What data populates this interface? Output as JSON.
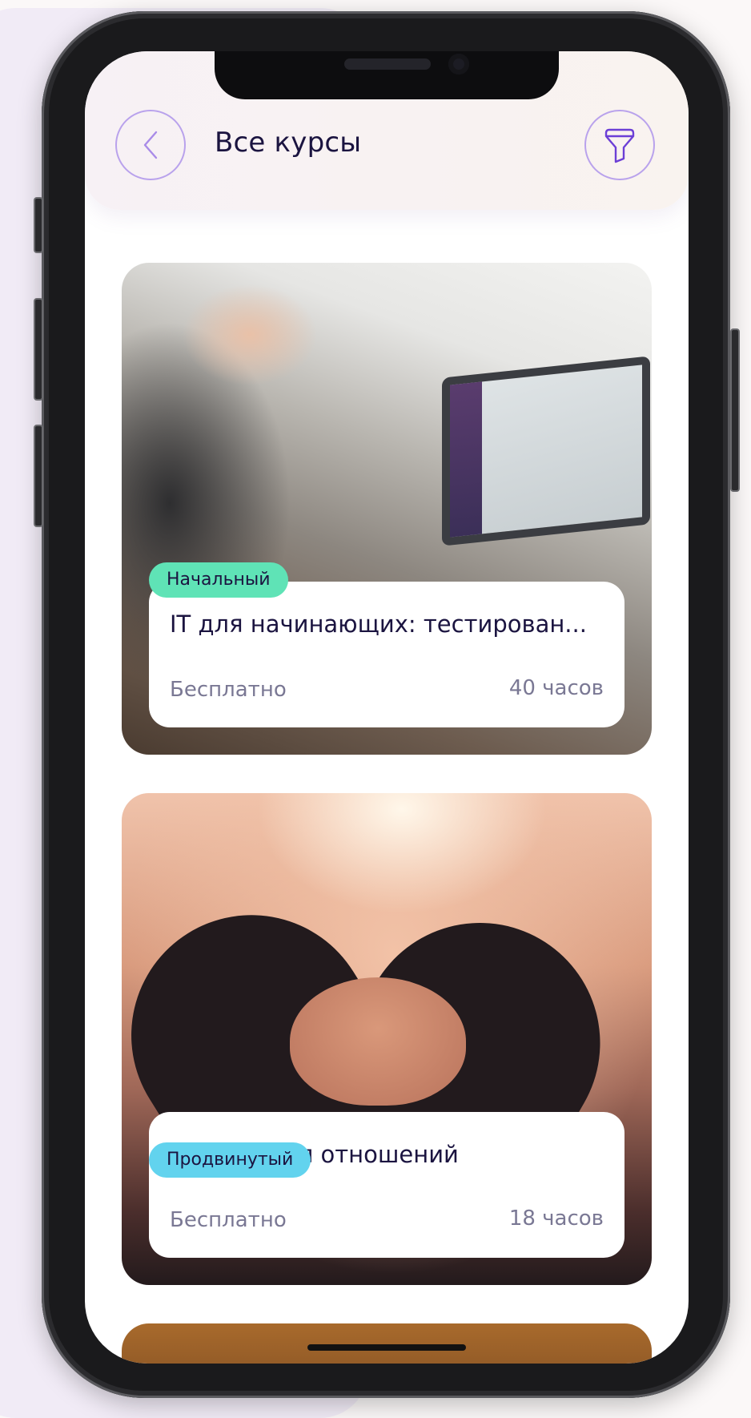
{
  "header": {
    "title": "Все курсы",
    "back_icon": "chevron-left-icon",
    "filter_icon": "filter-icon"
  },
  "courses": [
    {
      "level": "Начальный",
      "level_color": "#5fe3b6",
      "title": "IT для начинающих: тестирован...",
      "price": "Бесплатно",
      "duration": "40 часов"
    },
    {
      "level": "Продвинутый",
      "level_color": "#62d3ee",
      "title": "Психология отношений",
      "price": "Бесплатно",
      "duration": "18 часов"
    }
  ],
  "colors": {
    "accent": "#b9a2ec",
    "title_text": "#1b1440",
    "muted_text": "#7a7894"
  }
}
